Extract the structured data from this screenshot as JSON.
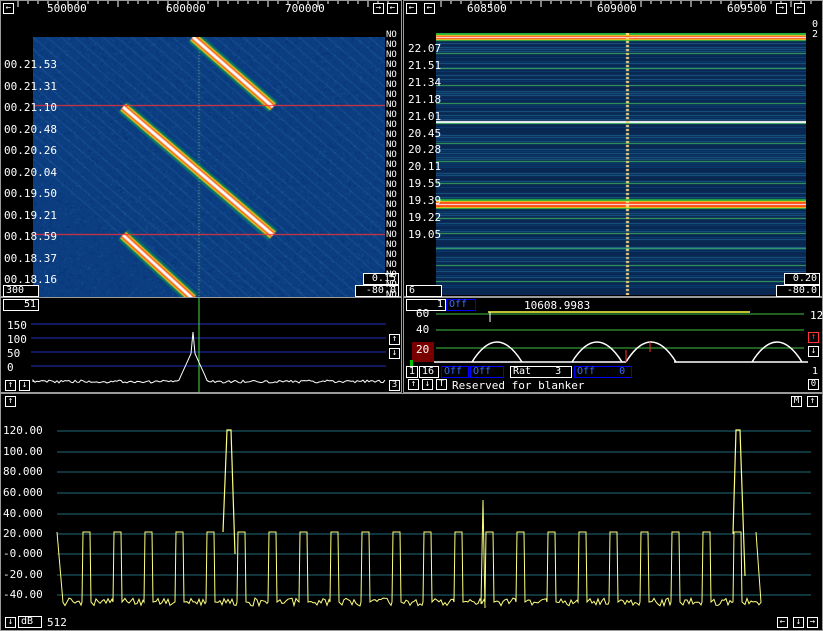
{
  "waterfall_left": {
    "freq_ticks": [
      "500000",
      "600000",
      "700000"
    ],
    "time_labels": [
      "00.21.53",
      "00.21.31",
      "00.21.10",
      "00.20.48",
      "00.20.26",
      "00.20.04",
      "00.19.50",
      "00.19.21",
      "00.18.59",
      "00.18.37",
      "00.18.16"
    ],
    "no_label": "NO",
    "gain_box": "0.15",
    "zero_box": "-80.0",
    "avg_box": "300",
    "colors": {
      "bg": "#0a3a7a",
      "trace": "#ffffff",
      "marker": "#ff2020"
    }
  },
  "waterfall_right": {
    "freq_ticks": [
      "608500",
      "609000",
      "609500"
    ],
    "time_labels": [
      "22.07",
      "21.51",
      "21.34",
      "21.18",
      "21.01",
      "20.45",
      "20.28",
      "20.11",
      "19.55",
      "19.39",
      "19.22",
      "19.05"
    ],
    "corner_top": "0",
    "corner_top2": "2",
    "gain_box": "0.20",
    "zero_box": "-80.0",
    "avg_box": "6"
  },
  "spectrum_left": {
    "avg_box": "51",
    "y_labels": [
      "150",
      "100",
      "50",
      "0"
    ],
    "right_box": "3"
  },
  "baseband": {
    "left_box": "1",
    "off_label": "Off",
    "freq_readout": "10608.9983",
    "y_labels": [
      "60",
      "40",
      "20"
    ],
    "right_num": "12",
    "bottom_right_num": "1",
    "row2_box1": "1",
    "row2_box2": "16",
    "off1": "Off",
    "off2": "Off",
    "rat_label": "Rat",
    "rat_value": "3",
    "off3": "Off",
    "off3_val": "0",
    "status_text": "Reserved for blanker",
    "right_bottom_box": "0"
  },
  "high_res": {
    "y_labels": [
      "120.00",
      "100.00",
      "80.000",
      "60.000",
      "40.000",
      "20.000",
      "-0.000",
      "-20.00",
      "-40.00"
    ],
    "db_label": "dB",
    "fft_size": "512",
    "m_button": "M"
  },
  "icons": {
    "left": "arrow-left-icon",
    "right": "arrow-right-icon",
    "up": "arrow-up-icon",
    "down": "arrow-down-icon"
  }
}
